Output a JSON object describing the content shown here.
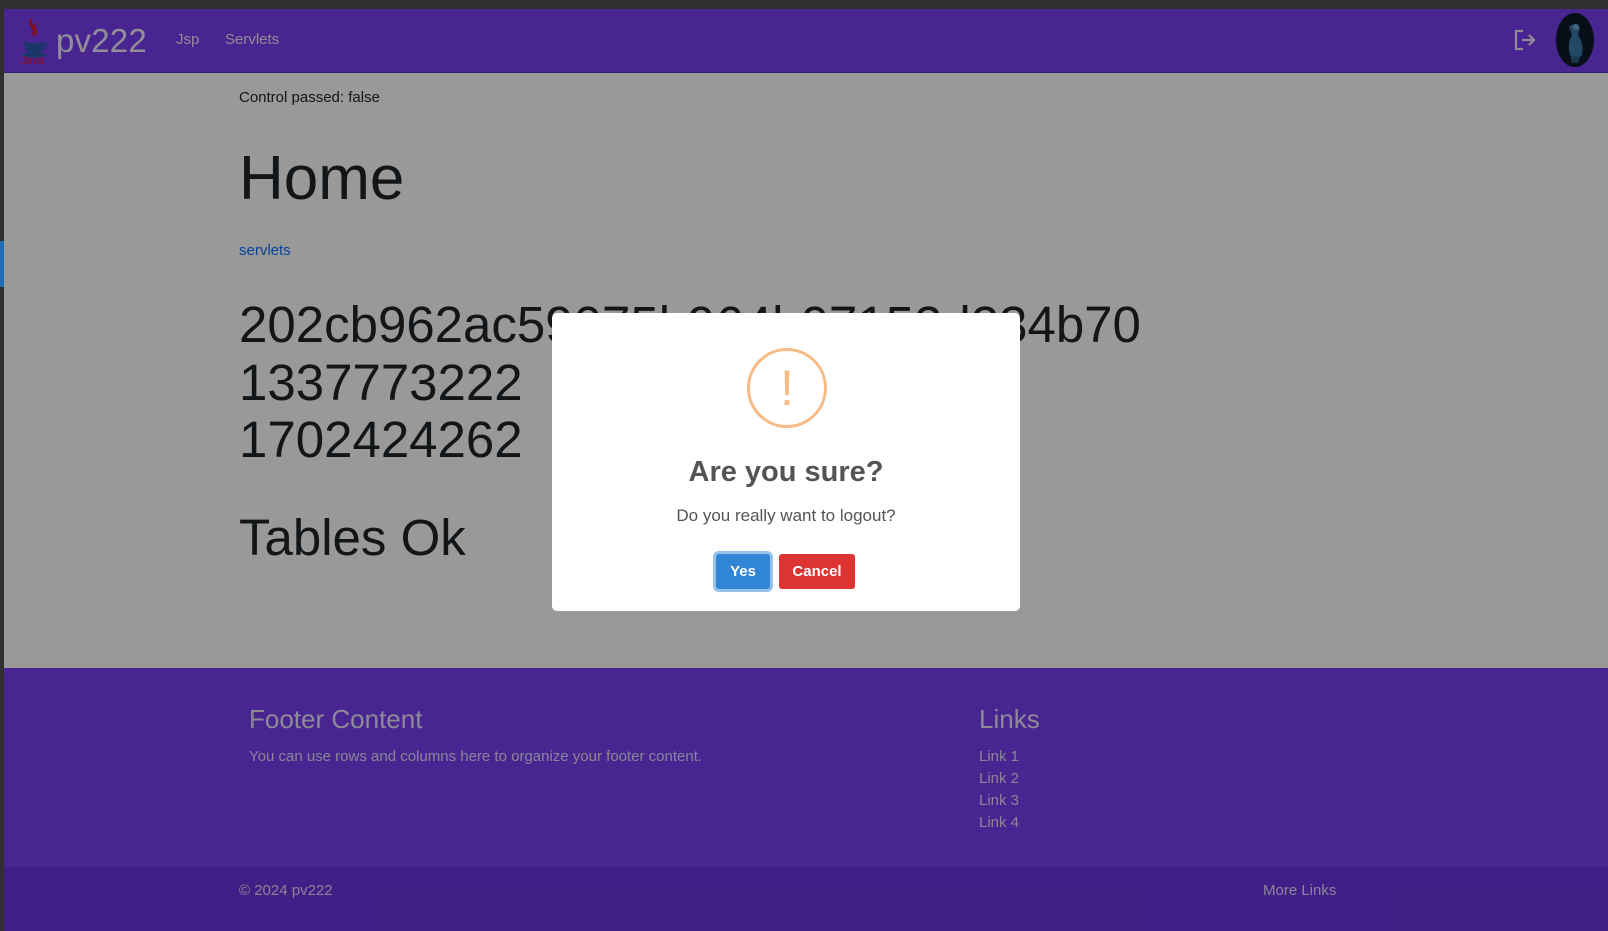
{
  "navbar": {
    "brand_text": "pv222",
    "java_logo_text": "Java",
    "links": [
      "Jsp",
      "Servlets"
    ],
    "logout_icon": "logout-icon",
    "avatar_icon": "user-avatar"
  },
  "main": {
    "control_text": "Control passed: false",
    "title": "Home",
    "servlets_link": "servlets",
    "hash_lines": [
      "202cb962ac59075b964b07152d234b70",
      "1337773222",
      "1702424262"
    ],
    "tables_status": "Tables Ok"
  },
  "footer": {
    "heading": "Footer Content",
    "text": "You can use rows and columns here to organize your footer content.",
    "links_heading": "Links",
    "links": [
      "Link 1",
      "Link 2",
      "Link 3",
      "Link 4"
    ],
    "copyright": "© 2024 pv222",
    "more_links": "More Links"
  },
  "dialog": {
    "icon": "warning-icon",
    "icon_glyph": "!",
    "title": "Are you sure?",
    "text": "Do you really want to logout?",
    "confirm_label": "Yes",
    "cancel_label": "Cancel"
  },
  "colors": {
    "navbar": "#7b3ff2",
    "confirm": "#3085d6",
    "cancel": "#dd3333",
    "warning": "#f8bb86"
  }
}
